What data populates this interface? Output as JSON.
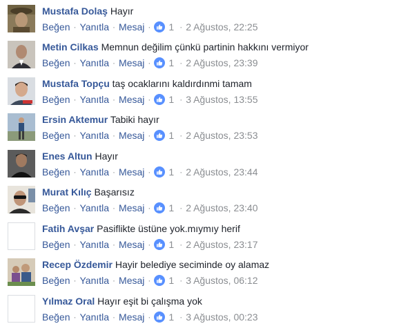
{
  "actions": {
    "like": "Beğen",
    "reply": "Yanıtla",
    "message": "Mesaj",
    "separator": "·"
  },
  "comments": [
    {
      "author": "Mustafa Dolaş",
      "text": "Hayır",
      "likes": "1",
      "timestamp": "2 Ağustos, 22:25",
      "avatar": "photo-man-hat-icon"
    },
    {
      "author": "Metin Cilkas",
      "text": "Memnun değilim çünkü partinin hakkını vermiyor",
      "likes": "1",
      "timestamp": "2 Ağustos, 23:39",
      "avatar": "photo-man-suit-icon"
    },
    {
      "author": "Mustafa Topçu",
      "text": "taş ocaklarını kaldırdınmi tamam",
      "likes": "1",
      "timestamp": "3 Ağustos, 13:55",
      "avatar": "photo-man-portrait-icon"
    },
    {
      "author": "Ersin Aktemur",
      "text": "Tabiki hayır",
      "likes": "1",
      "timestamp": "2 Ağustos, 23:53",
      "avatar": "photo-man-standing-icon"
    },
    {
      "author": "Enes Altun",
      "text": "Hayır",
      "likes": "1",
      "timestamp": "2 Ağustos, 23:44",
      "avatar": "photo-man-dark-icon"
    },
    {
      "author": "Murat Kılıç",
      "text": "Başarısız",
      "likes": "1",
      "timestamp": "2 Ağustos, 23:40",
      "avatar": "photo-man-sunglasses-icon"
    },
    {
      "author": "Fatih Avşar",
      "text": "Pasiflikte üstüne yok.mıymıy herif",
      "likes": "1",
      "timestamp": "2 Ağustos, 23:17",
      "avatar": "blank"
    },
    {
      "author": "Recep Özdemir",
      "text": "Hayir belediye seciminde oy alamaz",
      "likes": "1",
      "timestamp": "3 Ağustos, 06:12",
      "avatar": "photo-group-icon"
    },
    {
      "author": "Yılmaz Oral",
      "text": "Hayır eşit bi çalışma yok",
      "likes": "1",
      "timestamp": "3 Ağustos, 00:23",
      "avatar": "blank"
    }
  ],
  "colors": {
    "author": "#365899",
    "meta": "#8a8d91",
    "like_badge": "#5890ff"
  }
}
